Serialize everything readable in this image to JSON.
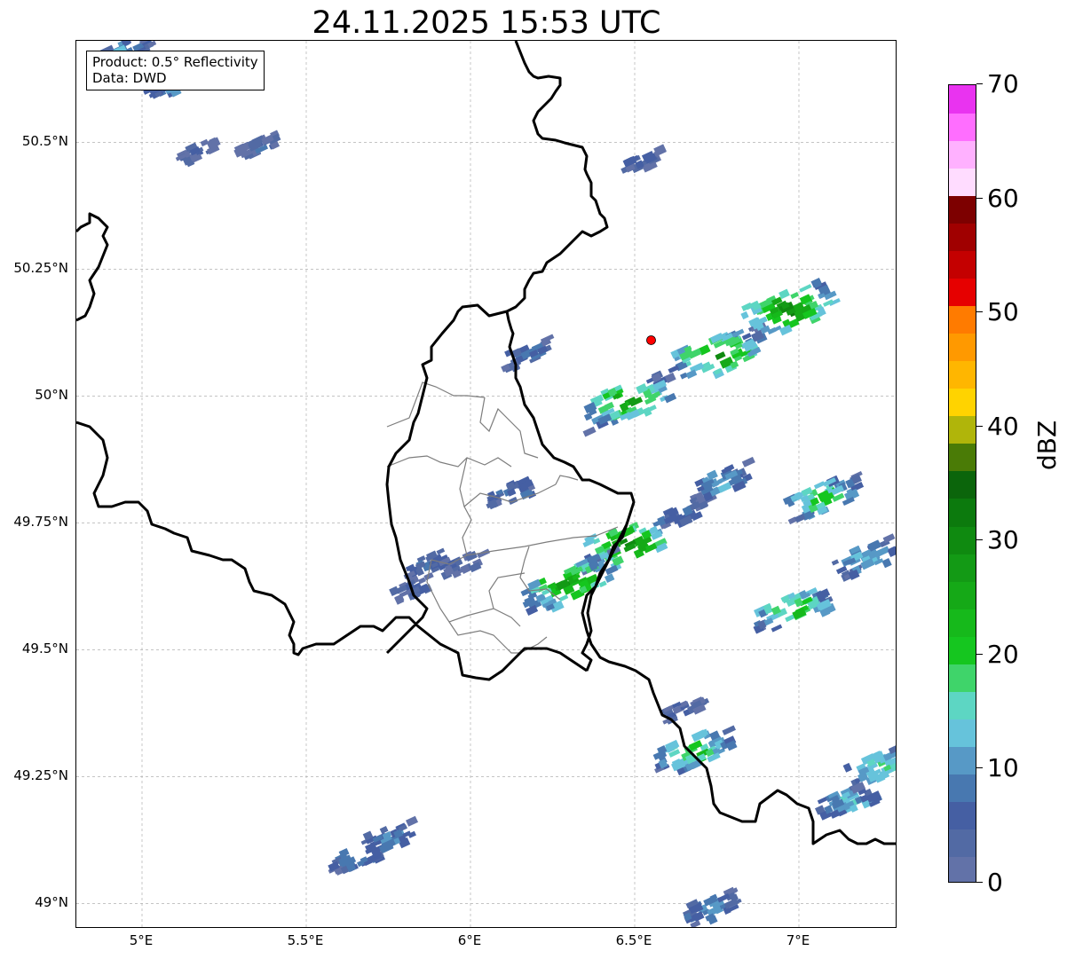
{
  "title": "24.11.2025 15:53 UTC",
  "info": {
    "product_line": "Product: 0.5° Reflectivity",
    "data_line": "Data: DWD"
  },
  "map": {
    "lon_range": [
      4.8,
      7.3
    ],
    "lat_range": [
      48.95,
      50.7
    ],
    "lat_ticks": [
      "50.5°N",
      "50.25°N",
      "50°N",
      "49.75°N",
      "49.5°N",
      "49.25°N",
      "49°N"
    ],
    "lat_tick_values": [
      50.5,
      50.25,
      50.0,
      49.75,
      49.5,
      49.25,
      49.0
    ],
    "lon_ticks": [
      "5°E",
      "5.5°E",
      "6°E",
      "6.5°E",
      "7°E"
    ],
    "lon_tick_values": [
      5.0,
      5.5,
      6.0,
      6.5,
      7.0
    ],
    "gridlines": true,
    "radar_site": {
      "lon": 6.55,
      "lat": 50.11,
      "color": "#ff0000"
    }
  },
  "colorbar": {
    "label": "dBZ",
    "ticks": [
      "0",
      "10",
      "20",
      "30",
      "40",
      "50",
      "60",
      "70"
    ],
    "tick_values": [
      0,
      10,
      20,
      30,
      40,
      50,
      60,
      70
    ],
    "min": 0,
    "max": 70,
    "colors": [
      "#6272a8",
      "#526aa4",
      "#455fa3",
      "#4878b0",
      "#5799c6",
      "#66c3db",
      "#5dd6c3",
      "#3fd46a",
      "#15c61f",
      "#16b91b",
      "#15a917",
      "#139a15",
      "#0f8a10",
      "#0c7a0d",
      "#0b650b",
      "#4a7b06",
      "#b0b50a",
      "#ffd300",
      "#ffb600",
      "#ff9900",
      "#ff7b00",
      "#e60000",
      "#c40000",
      "#a00000",
      "#7d0000",
      "#ffdcff",
      "#ffb1ff",
      "#ff6eff",
      "#e933f0"
    ]
  },
  "chart_data": {
    "type": "heatmap",
    "title": "24.11.2025 15:53 UTC",
    "xlabel": "",
    "ylabel": "",
    "xlim": [
      4.8,
      7.3
    ],
    "ylim": [
      48.95,
      50.7
    ],
    "colorbar_label": "dBZ",
    "colorbar_range": [
      0,
      70
    ],
    "echo_regions": [
      {
        "lon": 5.1,
        "lat": 50.62,
        "dbz": 15
      },
      {
        "lon": 4.95,
        "lat": 50.68,
        "dbz": 12
      },
      {
        "lon": 5.17,
        "lat": 50.48,
        "dbz": 6
      },
      {
        "lon": 5.35,
        "lat": 50.49,
        "dbz": 6
      },
      {
        "lon": 6.52,
        "lat": 50.46,
        "dbz": 6
      },
      {
        "lon": 6.17,
        "lat": 50.08,
        "dbz": 10
      },
      {
        "lon": 6.75,
        "lat": 50.08,
        "dbz": 30
      },
      {
        "lon": 6.97,
        "lat": 50.17,
        "dbz": 32
      },
      {
        "lon": 6.48,
        "lat": 49.99,
        "dbz": 28
      },
      {
        "lon": 6.13,
        "lat": 49.81,
        "dbz": 10
      },
      {
        "lon": 6.76,
        "lat": 49.83,
        "dbz": 15
      },
      {
        "lon": 6.65,
        "lat": 49.77,
        "dbz": 8
      },
      {
        "lon": 7.07,
        "lat": 49.8,
        "dbz": 22
      },
      {
        "lon": 6.48,
        "lat": 49.71,
        "dbz": 30
      },
      {
        "lon": 6.3,
        "lat": 49.63,
        "dbz": 30
      },
      {
        "lon": 5.87,
        "lat": 49.67,
        "dbz": 8
      },
      {
        "lon": 5.82,
        "lat": 49.62,
        "dbz": 6
      },
      {
        "lon": 5.98,
        "lat": 49.67,
        "dbz": 6
      },
      {
        "lon": 6.98,
        "lat": 49.58,
        "dbz": 24
      },
      {
        "lon": 7.2,
        "lat": 49.68,
        "dbz": 16
      },
      {
        "lon": 6.65,
        "lat": 49.38,
        "dbz": 6
      },
      {
        "lon": 6.68,
        "lat": 49.3,
        "dbz": 24
      },
      {
        "lon": 7.15,
        "lat": 49.2,
        "dbz": 16
      },
      {
        "lon": 7.25,
        "lat": 49.27,
        "dbz": 20
      },
      {
        "lon": 5.75,
        "lat": 49.13,
        "dbz": 12
      },
      {
        "lon": 5.65,
        "lat": 49.09,
        "dbz": 12
      },
      {
        "lon": 6.73,
        "lat": 48.99,
        "dbz": 14
      }
    ]
  }
}
